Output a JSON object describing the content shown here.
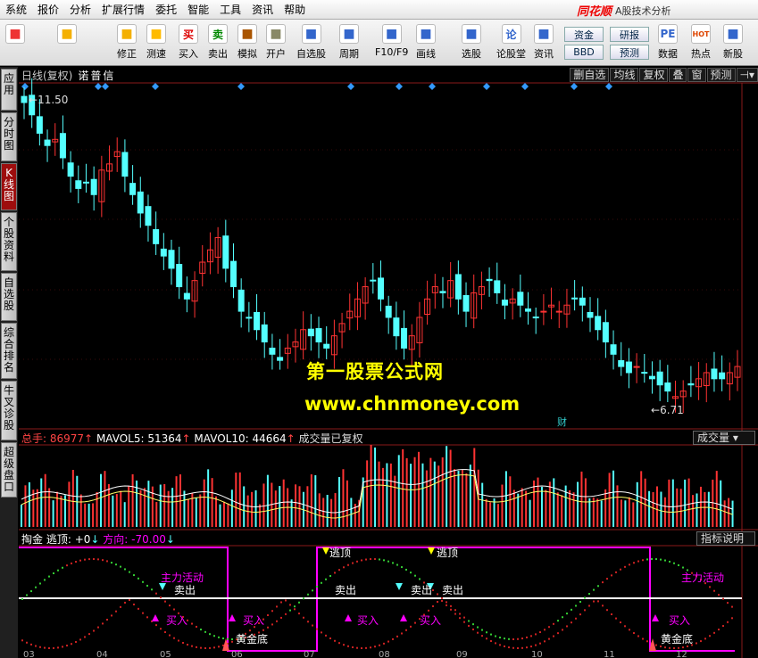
{
  "menu": [
    "系统",
    "报价",
    "分析",
    "扩展行情",
    "委托",
    "智能",
    "工具",
    "资讯",
    "帮助"
  ],
  "brand": {
    "logo": "同花顺",
    "subtitle": "A股技术分析"
  },
  "toolbar": [
    {
      "label": "",
      "icon": "app-grid-icon",
      "color": "#e33"
    },
    {
      "label": "",
      "icon": "back-arrow-icon",
      "color": "#f4b000"
    },
    {
      "label": "修正",
      "icon": "refresh-icon",
      "color": "#f4b000"
    },
    {
      "label": "测速",
      "icon": "stopwatch-icon",
      "color": "#fb0"
    },
    {
      "label": "买入",
      "icon": "buy-icon",
      "glyph": "买",
      "color": "#d00"
    },
    {
      "label": "卖出",
      "icon": "sell-icon",
      "glyph": "卖",
      "color": "#080"
    },
    {
      "label": "模拟",
      "icon": "gavel-icon",
      "color": "#a50"
    },
    {
      "label": "开户",
      "icon": "lock-icon",
      "color": "#886"
    },
    {
      "label": "自选股",
      "icon": "star-icon",
      "color": "#36c"
    },
    {
      "label": "周期",
      "icon": "clock-icon",
      "color": "#36c"
    },
    {
      "label": "F10/F9",
      "icon": "document-icon",
      "color": "#36c"
    },
    {
      "label": "画线",
      "icon": "pencil-icon",
      "color": "#36c"
    },
    {
      "label": "选股",
      "icon": "screen-icon",
      "color": "#36c"
    },
    {
      "label": "论股堂",
      "icon": "discussion-icon",
      "glyph": "论",
      "color": "#36c"
    },
    {
      "label": "资讯",
      "icon": "news-icon",
      "color": "#36c"
    },
    {
      "label": "数据",
      "icon": "pe-icon",
      "glyph": "PE",
      "color": "#36c"
    },
    {
      "label": "热点",
      "icon": "hot-icon",
      "glyph": "HOT",
      "color": "#d40"
    },
    {
      "label": "新股",
      "icon": "new-stock-icon",
      "color": "#36c"
    }
  ],
  "pills": [
    "资金",
    "BBD",
    "研报",
    "预测"
  ],
  "left_tabs": [
    {
      "label": "应用",
      "active": false
    },
    {
      "label": "分时图",
      "active": false
    },
    {
      "label": "K线图",
      "active": true
    },
    {
      "label": "个股资料",
      "active": false
    },
    {
      "label": "自选股",
      "active": false
    },
    {
      "label": "综合排名",
      "active": false
    },
    {
      "label": "牛叉诊股",
      "active": false
    },
    {
      "label": "超级盘口",
      "active": false
    }
  ],
  "price_panel": {
    "period": "日线(复权)",
    "stock_name": "诺普信",
    "high_label": "11.50",
    "low_label": "6.71",
    "fin_marker": "财"
  },
  "right_buttons": [
    "删自选",
    "均线",
    "复权",
    "叠",
    "窗",
    "预测"
  ],
  "volume_panel": {
    "total": "总手: 86977",
    "total_arrow": "↑",
    "mavol5": "MAVOL5: 51364",
    "mavol5_arrow": "↑",
    "mavol10": "MAVOL10: 44664",
    "mavol10_arrow": "↑",
    "note": "成交量已复权",
    "selector": "成交量"
  },
  "indicator_panel": {
    "name": "掏金",
    "escape": "逃顶: +0",
    "escape_arrow": "↓",
    "direction": "方向: -70.00",
    "direction_arrow": "↓",
    "help": "指标说明"
  },
  "watermark": {
    "line1": "第一股票公式网",
    "line2": "www.chnmoney.com"
  },
  "signals": {
    "escape": [
      "逃顶",
      "逃顶"
    ],
    "main_force": [
      "主力活动",
      "主力活动"
    ],
    "buy": [
      "买入",
      "买入",
      "买入",
      "买入",
      "买入"
    ],
    "sell": [
      "卖出",
      "卖出",
      "卖出",
      "卖出"
    ],
    "bottom": [
      "黄金底",
      "黄金底"
    ]
  },
  "bottom_ticks": [
    "03",
    "04",
    "05",
    "06",
    "07",
    "08",
    "09",
    "10",
    "11",
    "12"
  ],
  "colors": {
    "up": "#ff3333",
    "down": "#54ffff",
    "grid": "#8a1a1a",
    "accent": "#ff00ff",
    "signal": "#ffff00",
    "diamond": "#3399ff"
  },
  "chart_data": {
    "type": "candlestick",
    "price_range": [
      6.71,
      11.5
    ],
    "closes": [
      11.5,
      11.3,
      11.0,
      10.8,
      10.9,
      10.6,
      10.3,
      10.1,
      10.2,
      10.0,
      10.4,
      10.5,
      10.7,
      10.3,
      10.0,
      9.7,
      9.5,
      9.2,
      9.0,
      8.8,
      8.5,
      8.3,
      8.6,
      8.9,
      9.1,
      9.3,
      8.8,
      8.5,
      8.1,
      8.0,
      7.8,
      7.6,
      7.4,
      7.3,
      7.5,
      7.6,
      7.8,
      7.7,
      7.6,
      7.5,
      7.7,
      7.9,
      8.1,
      8.3,
      8.5,
      8.6,
      8.3,
      8.0,
      7.7,
      7.5,
      7.7,
      8.0,
      8.3,
      8.5,
      8.4,
      8.6,
      8.3,
      8.1,
      8.4,
      8.5,
      8.6,
      8.4,
      8.2,
      8.3,
      8.2,
      8.1,
      8.0,
      8.1,
      8.2,
      8.1,
      8.2,
      8.3,
      8.2,
      8.0,
      7.8,
      7.6,
      7.4,
      7.2,
      7.1,
      7.2,
      7.1,
      7.0,
      6.9,
      6.8,
      6.71,
      6.8,
      6.9,
      7.0,
      7.1,
      7.0,
      7.0,
      7.1,
      7.2
    ]
  }
}
